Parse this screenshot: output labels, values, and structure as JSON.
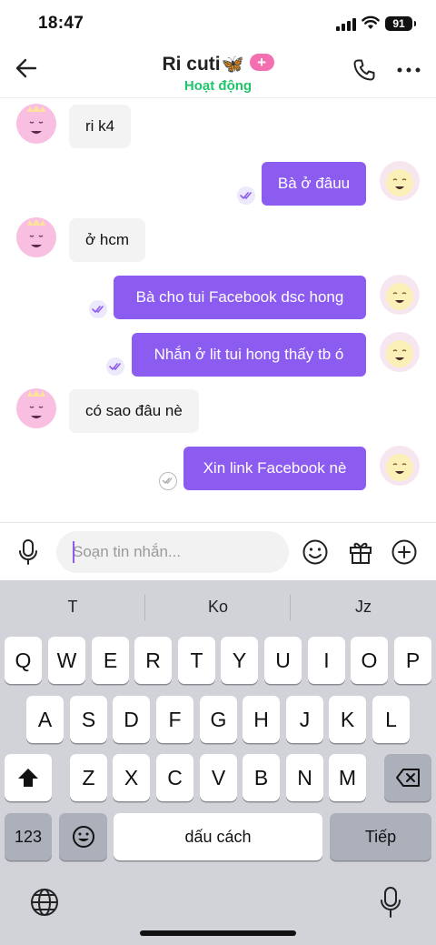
{
  "status_bar": {
    "time": "18:47",
    "battery": "91"
  },
  "header": {
    "title": "Ri cuti",
    "title_emoji": "🦋",
    "badge": "+",
    "status": "Hoạt động",
    "status_color": "#1fc46b",
    "icons": [
      "back-arrow-icon",
      "phone-icon",
      "more-icon"
    ]
  },
  "messages": [
    {
      "direction": "in",
      "text": "ri k4"
    },
    {
      "direction": "out",
      "text": "Bà ở đâuu",
      "seen": true
    },
    {
      "direction": "in",
      "text": "ở hcm"
    },
    {
      "direction": "out",
      "text": "Bà cho tui Facebook dsc hong",
      "seen": true
    },
    {
      "direction": "out",
      "text": "Nhắn ở lit tui hong thấy tb ó",
      "seen": true
    },
    {
      "direction": "in",
      "text": "có sao đâu nè"
    },
    {
      "direction": "out",
      "text": "Xin link Facebook nè",
      "seen": false
    }
  ],
  "composer": {
    "placeholder": "Soạn tin nhắn...",
    "value": "",
    "icons": [
      "microphone-icon",
      "emoji-icon",
      "gift-icon",
      "add-icon"
    ]
  },
  "keyboard": {
    "suggestions": [
      "T",
      "Ko",
      "Jz"
    ],
    "row1": [
      "Q",
      "W",
      "E",
      "R",
      "T",
      "Y",
      "U",
      "I",
      "O",
      "P"
    ],
    "row2": [
      "A",
      "S",
      "D",
      "F",
      "G",
      "H",
      "J",
      "K",
      "L"
    ],
    "row3": [
      "Z",
      "X",
      "C",
      "V",
      "B",
      "N",
      "M"
    ],
    "numbers_label": "123",
    "space_label": "dấu cách",
    "return_label": "Tiếp"
  },
  "colors": {
    "accent": "#8c5cf0",
    "incoming_bubble": "#f3f3f3",
    "badge": "#f46fb0",
    "keyboard_bg": "#d1d3d9"
  }
}
